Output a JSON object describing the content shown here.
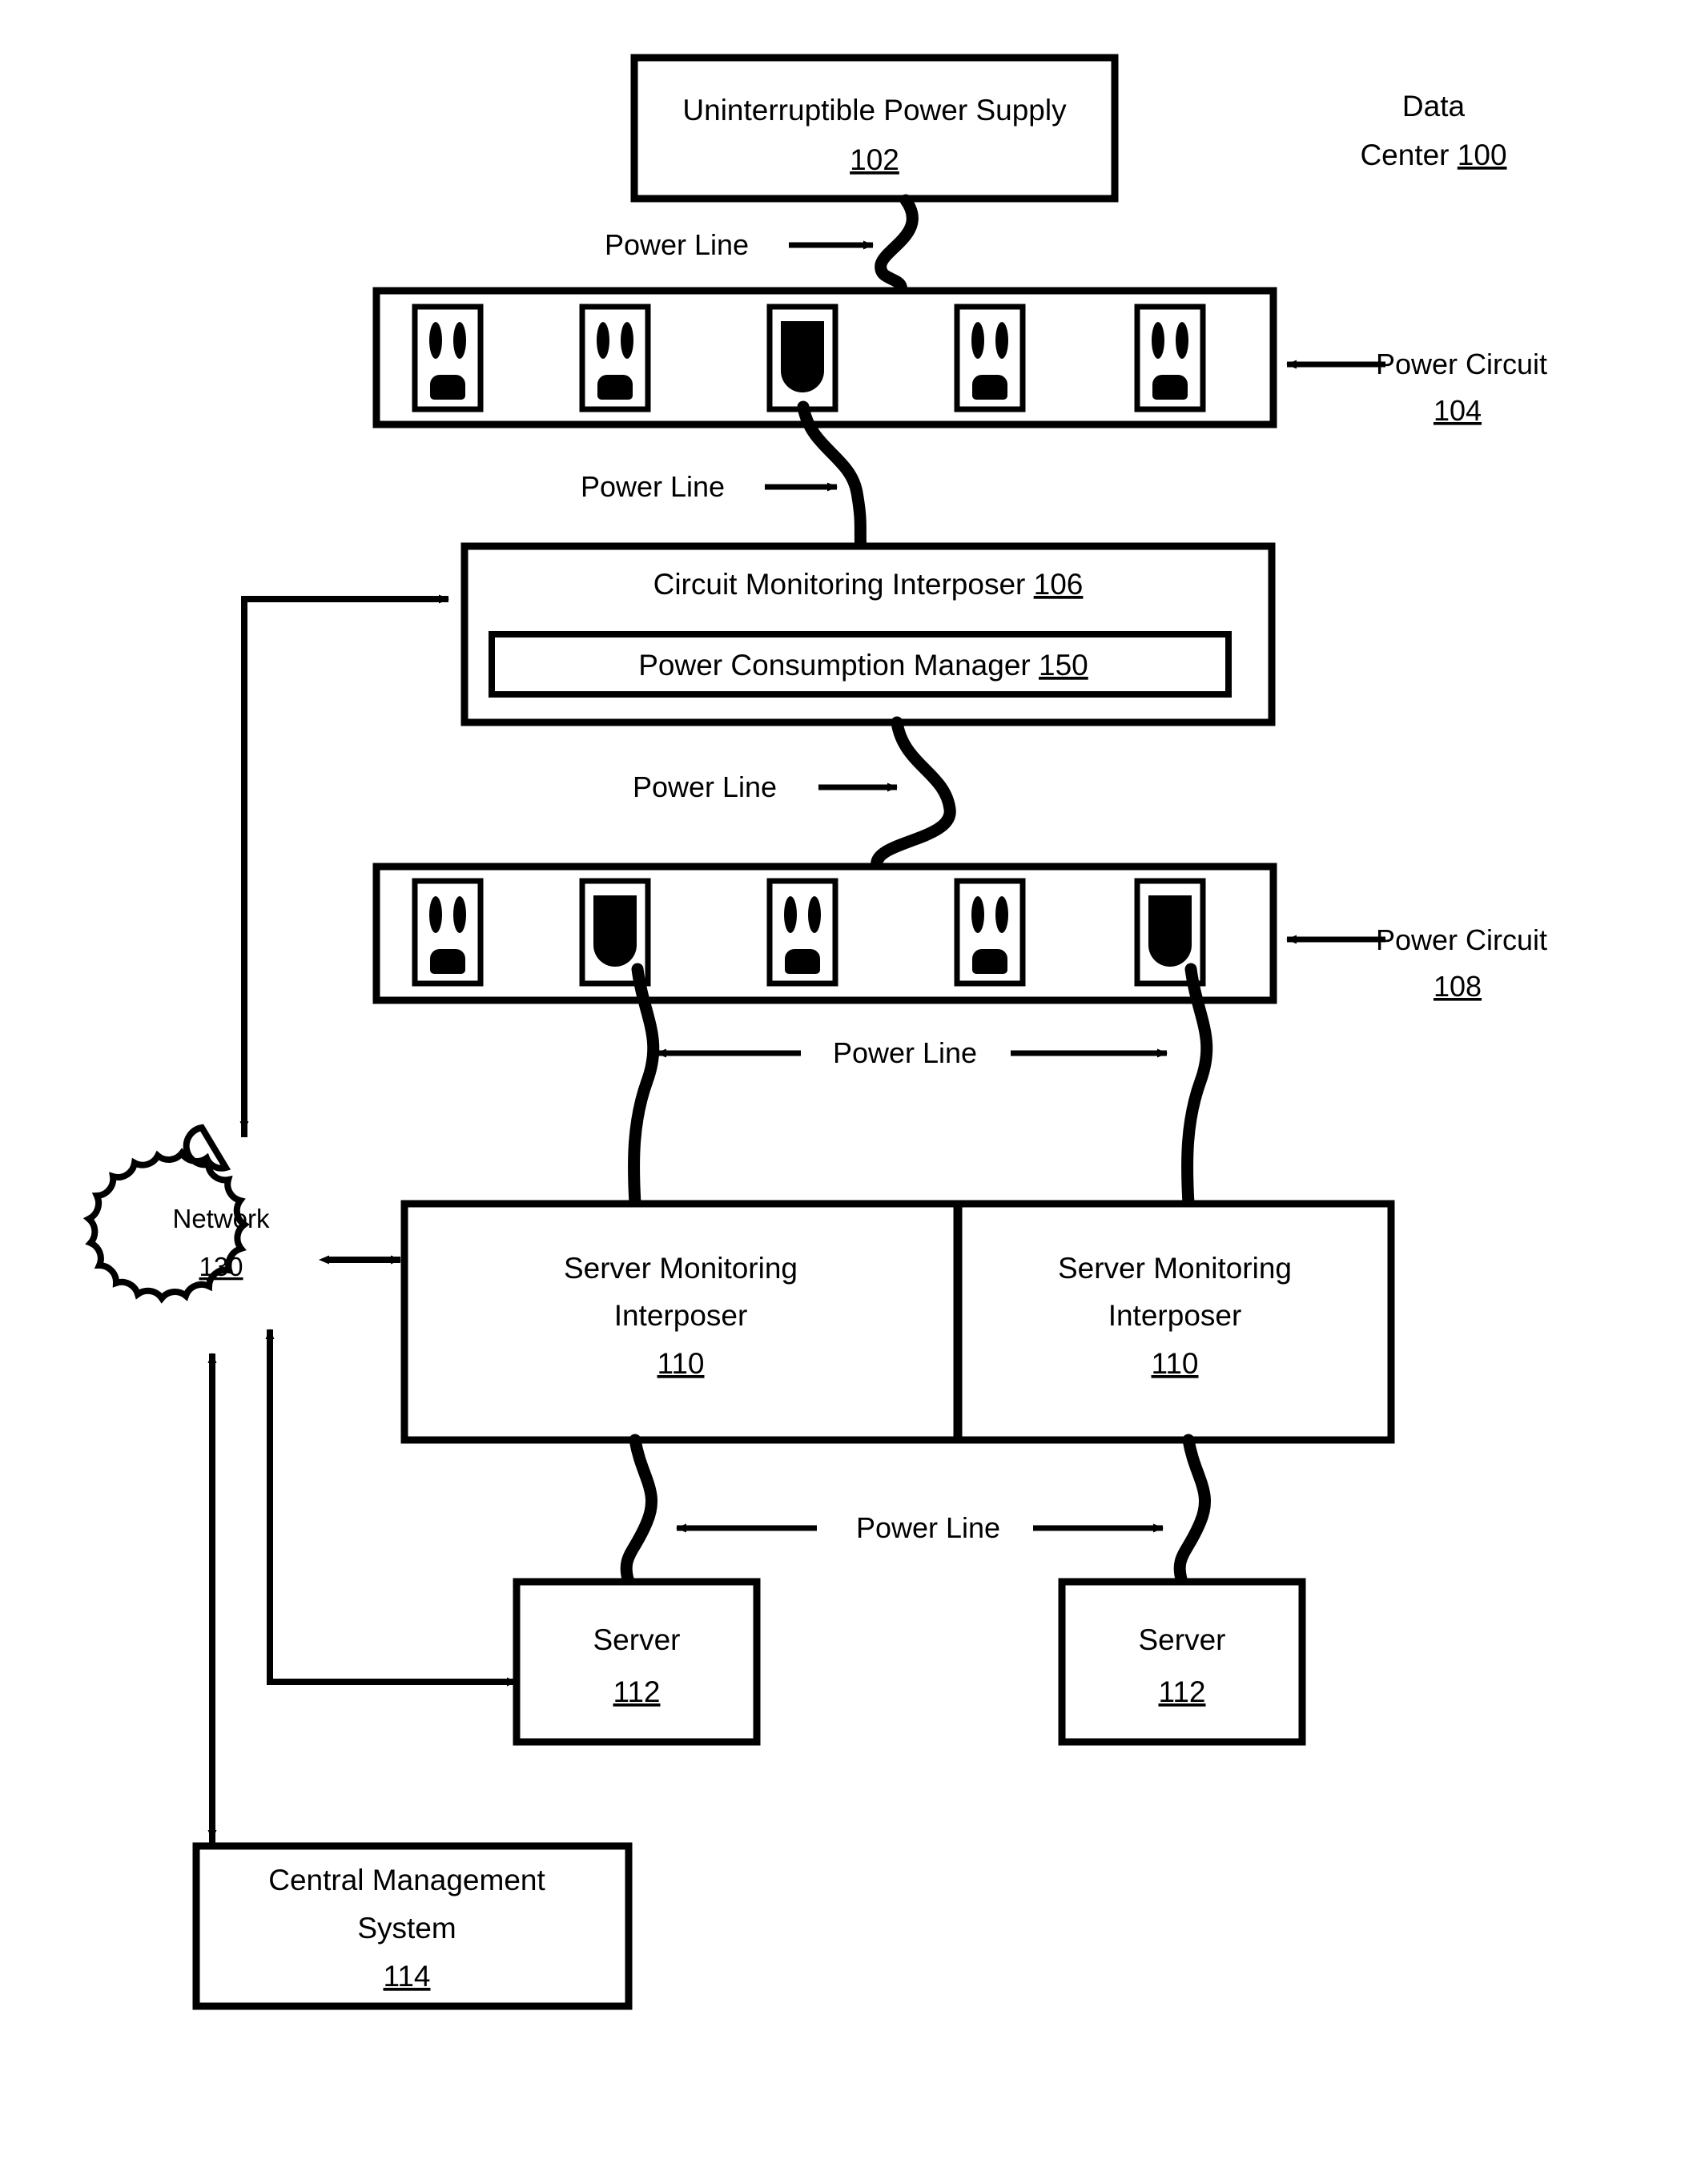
{
  "figure": {
    "domain": "patent-block-diagram",
    "corner_label": {
      "line1": "Data",
      "line2_prefix": "Center ",
      "line2_ref": "100"
    }
  },
  "blocks": {
    "ups": {
      "title": "Uninterruptible Power Supply",
      "ref": "102"
    },
    "circuit_monitoring_interposer": {
      "title": "Circuit Monitoring Interposer",
      "ref": "106",
      "inner": {
        "title": "Power Consumption Manager",
        "ref": "150"
      }
    },
    "power_circuit_104": {
      "label": "Power Circuit",
      "ref": "104",
      "outlet_count": 5,
      "plugged_outlets": [
        3
      ]
    },
    "power_circuit_108": {
      "label": "Power Circuit",
      "ref": "108",
      "outlet_count": 5,
      "plugged_outlets": [
        2,
        5
      ]
    },
    "network": {
      "title": "Network",
      "ref": "130"
    },
    "server_monitoring_interposer_left": {
      "title_line1": "Server Monitoring",
      "title_line2": "Interposer",
      "ref": "110"
    },
    "server_monitoring_interposer_right": {
      "title_line1": "Server Monitoring",
      "title_line2": "Interposer",
      "ref": "110"
    },
    "server_left": {
      "title": "Server",
      "ref": "112"
    },
    "server_right": {
      "title": "Server",
      "ref": "112"
    },
    "central_management_system": {
      "title_line1": "Central Management",
      "title_line2": "System",
      "ref": "114"
    }
  },
  "annotations": {
    "power_line_ups_to_circuit104": "Power Line",
    "power_line_circuit104_to_interposer106": "Power Line",
    "power_line_interposer106_to_circuit108": "Power Line",
    "power_line_circuit108_to_interposers110": "Power Line",
    "power_line_interposers110_to_servers112": "Power Line"
  },
  "colors": {
    "stroke": "#000000",
    "fill": "#ffffff",
    "plug": "#000000"
  }
}
